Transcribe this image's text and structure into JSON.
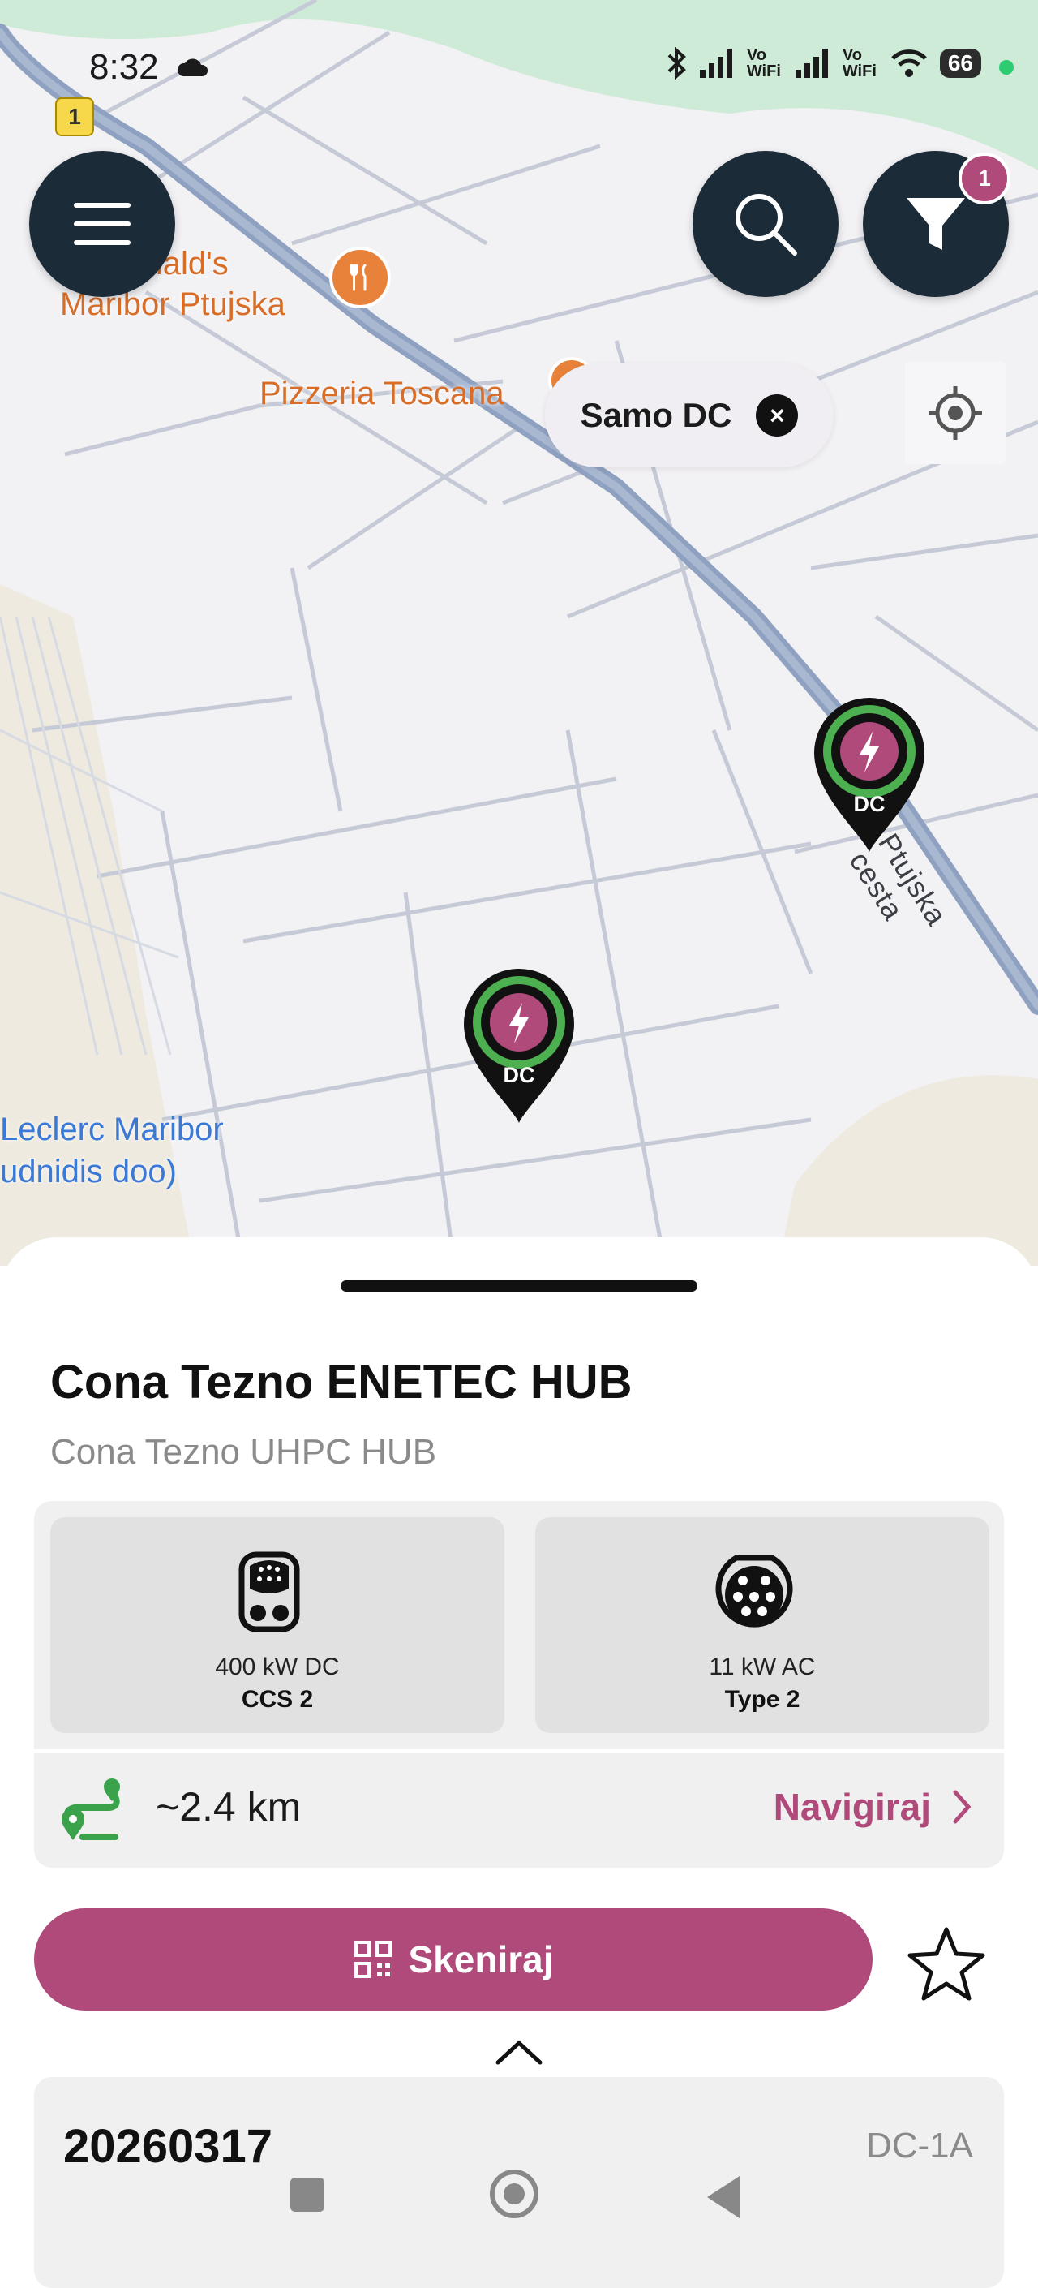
{
  "status_bar": {
    "time": "8:32",
    "net_label_1": "Vo WiFi",
    "net_label_2": "Vo WiFi",
    "battery": "66"
  },
  "map": {
    "route_shield": "1",
    "poi_1_line1": "McDonald's",
    "poi_1_line2": "Maribor Ptujska",
    "poi_2": "Pizzeria Toscana",
    "poi_3_line1": "Leclerc Maribor",
    "poi_3_line2": "udnidis doo)",
    "street": "Ptujska cesta",
    "pin_labels": [
      "DC",
      "DC"
    ]
  },
  "filter": {
    "badge": "1",
    "chip_label": "Samo DC"
  },
  "station": {
    "name": "Cona Tezno ENETEC HUB",
    "subtitle": "Cona Tezno UHPC HUB",
    "connectors": [
      {
        "power": "400 kW DC",
        "type": "CCS 2"
      },
      {
        "power": "11 kW AC",
        "type": "Type 2"
      }
    ],
    "distance": "~2.4 km",
    "navigate_label": "Navigiraj",
    "scan_label": "Skeniraj"
  },
  "charger": {
    "id": "20260317",
    "code": "DC-1A"
  },
  "colors": {
    "accent": "#b04a7b",
    "dark": "#1c2b38",
    "green": "#4caf50"
  }
}
